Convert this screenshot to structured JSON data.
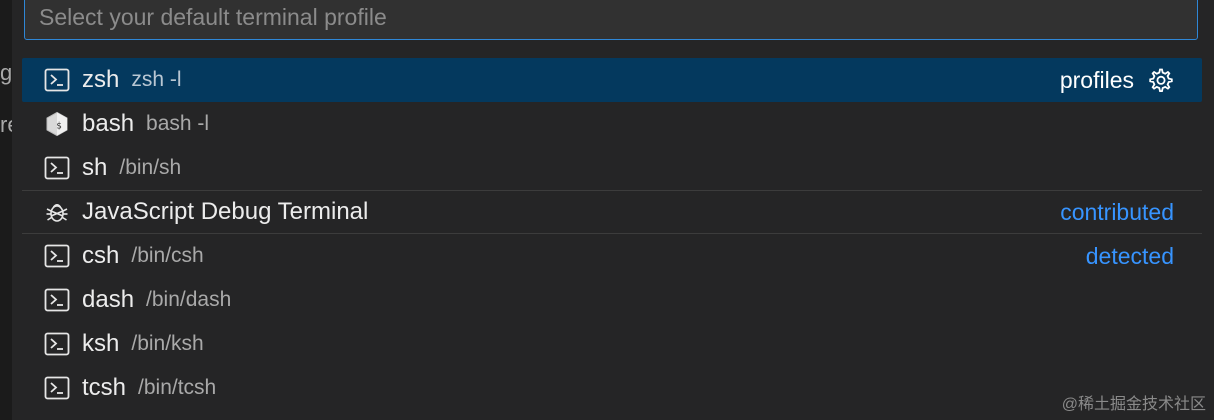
{
  "search": {
    "placeholder": "Select your default terminal profile",
    "value": ""
  },
  "behind": {
    "fragments": [
      "g",
      "re"
    ]
  },
  "items": [
    {
      "label": "zsh",
      "description": "zsh -l",
      "icon": "terminal-icon",
      "selected": true,
      "action_label": "profiles",
      "action_icon": "gear-icon"
    },
    {
      "label": "bash",
      "description": "bash -l",
      "icon": "bash-shell-icon"
    },
    {
      "label": "sh",
      "description": "/bin/sh",
      "icon": "terminal-icon"
    },
    {
      "label": "JavaScript Debug Terminal",
      "description": "",
      "icon": "debug-bug-icon",
      "group": "contributed"
    },
    {
      "label": "csh",
      "description": "/bin/csh",
      "icon": "terminal-icon",
      "group": "detected"
    },
    {
      "label": "dash",
      "description": "/bin/dash",
      "icon": "terminal-icon"
    },
    {
      "label": "ksh",
      "description": "/bin/ksh",
      "icon": "terminal-icon"
    },
    {
      "label": "tcsh",
      "description": "/bin/tcsh",
      "icon": "terminal-icon"
    }
  ],
  "watermark": "@稀土掘金技术社区",
  "colors": {
    "accent": "#3794ff",
    "selection": "#04395e",
    "focus_border": "#2f87d6",
    "background": "#252526"
  }
}
